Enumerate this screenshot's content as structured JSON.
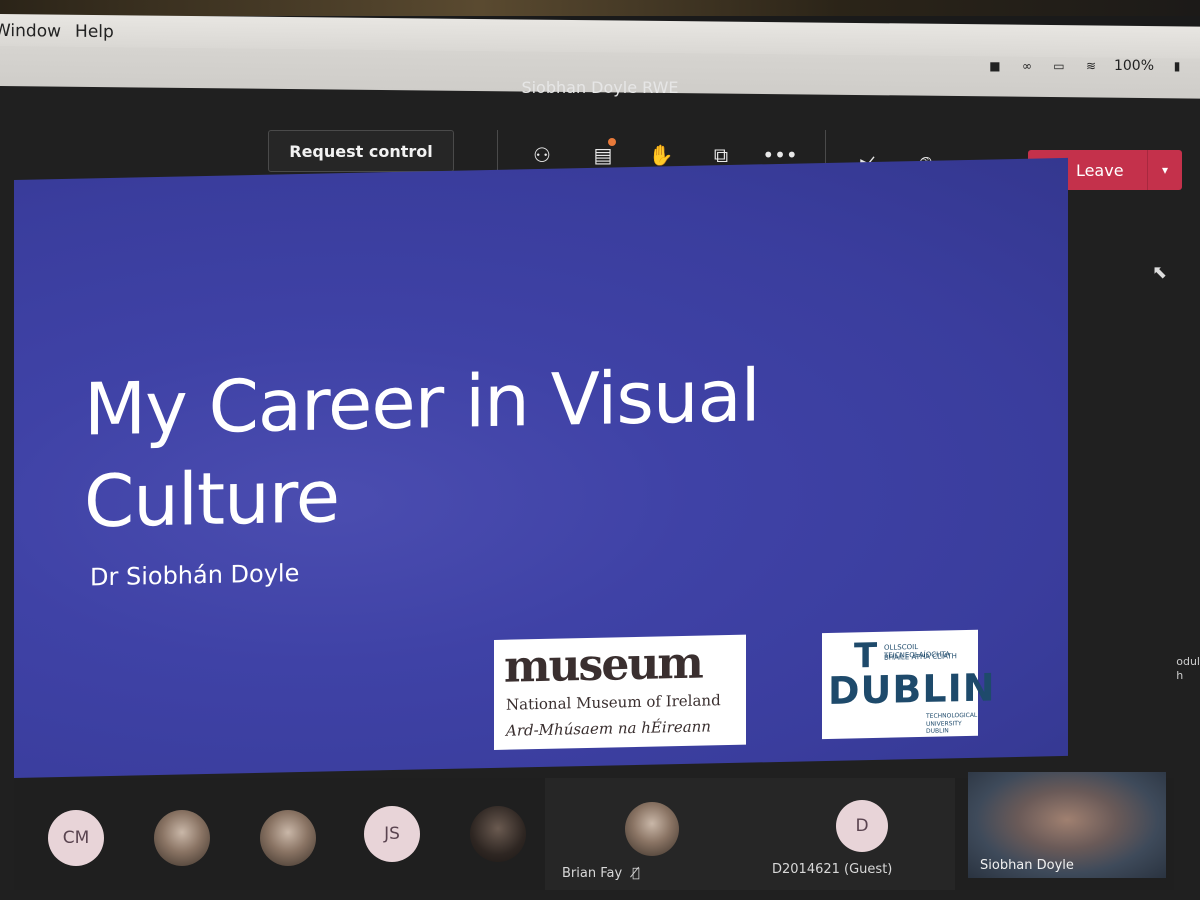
{
  "menubar": {
    "items": [
      "Window",
      "Help"
    ]
  },
  "tray": {
    "battery": "100%",
    "icons": [
      "camera-icon",
      "creative-cloud-icon",
      "airplay-icon",
      "wifi-icon",
      "battery-icon"
    ]
  },
  "window": {
    "title": "Siobhan Doyle RWE"
  },
  "controls": {
    "request_control": "Request control",
    "tools": [
      "people-icon",
      "chat-icon",
      "raise-hand-icon",
      "room-icon",
      "more-icon",
      "camera-off-icon",
      "mic-off-icon",
      "share-icon"
    ],
    "leave_label": "Leave",
    "accent": "#c4314b"
  },
  "slide": {
    "title_line1": "My Career in Visual",
    "title_line2": "Culture",
    "subtitle": "Dr Siobhán Doyle",
    "museum_logo": {
      "word": "museum",
      "line2": "National Museum of Ireland",
      "line3": "Ard-Mhúsaem na hÉireann"
    },
    "tu_logo": {
      "t": "T",
      "small1": "OLLSCOIL TEICNEOLAÍOCHTA",
      "small2": "BHAILE ÁTHA CLIATH",
      "dublin": "DUBLIN",
      "small3": "TECHNOLOGICAL",
      "small4": "UNIVERSITY DUBLIN"
    }
  },
  "participants": [
    {
      "initials": "CM"
    },
    {
      "initials": ""
    },
    {
      "initials": ""
    },
    {
      "initials": "JS"
    },
    {
      "initials": ""
    },
    {
      "name": "Brian Fay"
    },
    {
      "initials": "D",
      "name": "D2014621 (Guest)"
    }
  ],
  "self_view": {
    "name": "Siobhan Doyle"
  },
  "side_peek": {
    "line1": "odul",
    "line2": "h"
  }
}
